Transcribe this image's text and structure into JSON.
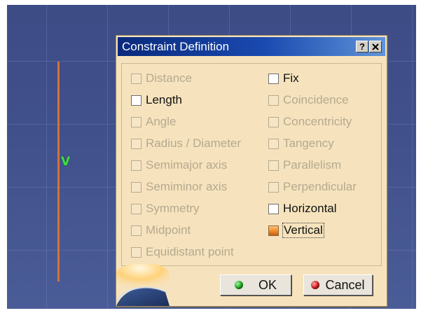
{
  "dialog": {
    "title": "Constraint Definition",
    "help_label": "?",
    "close_label": "✕"
  },
  "viewport": {
    "constraint_symbol": "V"
  },
  "options": {
    "left": [
      {
        "label": "Distance",
        "enabled": false,
        "checked": false
      },
      {
        "label": "Length",
        "enabled": true,
        "checked": false
      },
      {
        "label": "Angle",
        "enabled": false,
        "checked": false
      },
      {
        "label": "Radius / Diameter",
        "enabled": false,
        "checked": false
      },
      {
        "label": "Semimajor axis",
        "enabled": false,
        "checked": false
      },
      {
        "label": "Semiminor axis",
        "enabled": false,
        "checked": false
      },
      {
        "label": "Symmetry",
        "enabled": false,
        "checked": false
      },
      {
        "label": "Midpoint",
        "enabled": false,
        "checked": false
      },
      {
        "label": "Equidistant point",
        "enabled": false,
        "checked": false
      }
    ],
    "right": [
      {
        "label": "Fix",
        "enabled": true,
        "checked": false
      },
      {
        "label": "Coincidence",
        "enabled": false,
        "checked": false
      },
      {
        "label": "Concentricity",
        "enabled": false,
        "checked": false
      },
      {
        "label": "Tangency",
        "enabled": false,
        "checked": false
      },
      {
        "label": "Parallelism",
        "enabled": false,
        "checked": false
      },
      {
        "label": "Perpendicular",
        "enabled": false,
        "checked": false
      },
      {
        "label": "Horizontal",
        "enabled": true,
        "checked": false
      },
      {
        "label": "Vertical",
        "enabled": true,
        "checked": true
      }
    ]
  },
  "buttons": {
    "ok_label": "OK",
    "cancel_label": "Cancel"
  },
  "colors": {
    "title_bar": "#0a2a7c",
    "dialog_bg": "#f6e3bd",
    "viewport_bg": "#40508a",
    "sketch_line": "#d4723a",
    "constraint_symbol": "#3fe03f",
    "checked_box": "#f08a28"
  }
}
